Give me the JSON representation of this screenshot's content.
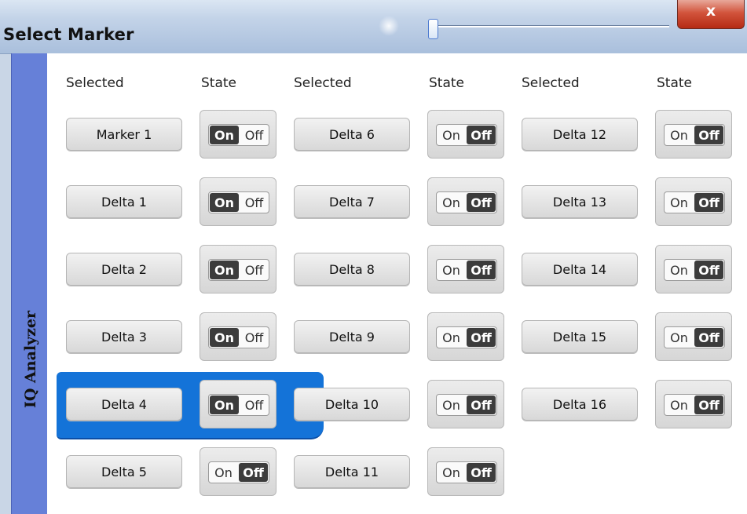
{
  "window": {
    "title": "Select Marker",
    "close_label": "x"
  },
  "sidebar": {
    "label": "IQ Analyzer"
  },
  "columns": {
    "selected_label": "Selected",
    "state_label": "State"
  },
  "markers": [
    {
      "name": "Marker 1",
      "on_label": "On",
      "off_label": "Off",
      "state": "on"
    },
    {
      "name": "Delta 1",
      "on_label": "On",
      "off_label": "Off",
      "state": "on"
    },
    {
      "name": "Delta 2",
      "on_label": "On",
      "off_label": "Off",
      "state": "on"
    },
    {
      "name": "Delta 3",
      "on_label": "On",
      "off_label": "Off",
      "state": "on"
    },
    {
      "name": "Delta 4",
      "on_label": "On",
      "off_label": "Off",
      "state": "on",
      "focused": true
    },
    {
      "name": "Delta 5",
      "on_label": "On",
      "off_label": "Off",
      "state": "off"
    },
    {
      "name": "Delta 6",
      "on_label": "On",
      "off_label": "Off",
      "state": "off"
    },
    {
      "name": "Delta 7",
      "on_label": "On",
      "off_label": "Off",
      "state": "off"
    },
    {
      "name": "Delta 8",
      "on_label": "On",
      "off_label": "Off",
      "state": "off"
    },
    {
      "name": "Delta 9",
      "on_label": "On",
      "off_label": "Off",
      "state": "off"
    },
    {
      "name": "Delta 10",
      "on_label": "On",
      "off_label": "Off",
      "state": "off"
    },
    {
      "name": "Delta 11",
      "on_label": "On",
      "off_label": "Off",
      "state": "off"
    },
    {
      "name": "Delta 12",
      "on_label": "On",
      "off_label": "Off",
      "state": "off"
    },
    {
      "name": "Delta 13",
      "on_label": "On",
      "off_label": "Off",
      "state": "off"
    },
    {
      "name": "Delta 14",
      "on_label": "On",
      "off_label": "Off",
      "state": "off"
    },
    {
      "name": "Delta 15",
      "on_label": "On",
      "off_label": "Off",
      "state": "off"
    },
    {
      "name": "Delta 16",
      "on_label": "On",
      "off_label": "Off",
      "state": "off"
    }
  ],
  "colors": {
    "selection_blue": "#1473d8",
    "sidebar_blue": "#6680d8",
    "toggle_active": "#3c3c3c"
  }
}
